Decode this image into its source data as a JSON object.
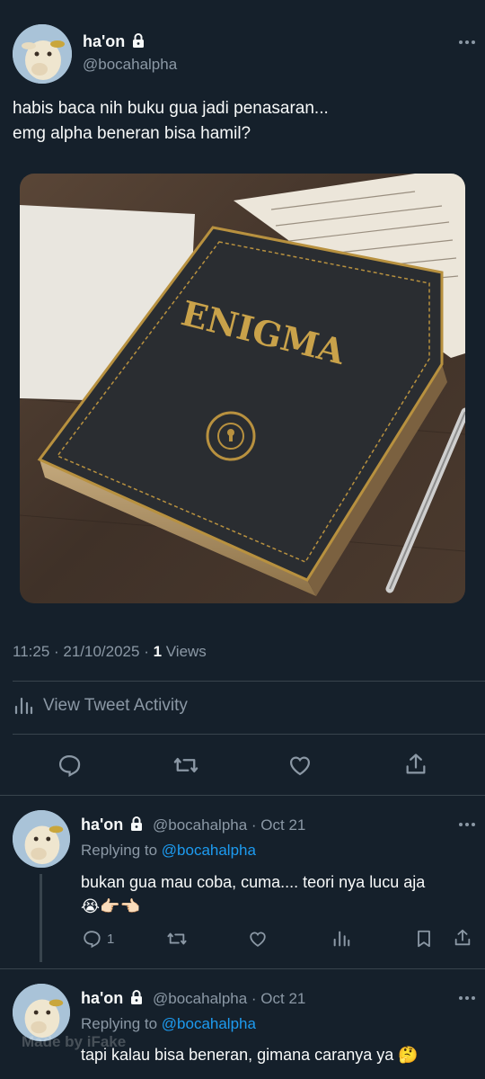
{
  "tweet": {
    "author_name": "ha'on",
    "author_handle": "@bocahalpha",
    "text_line1": "habis baca nih buku gua jadi penasaran...",
    "text_line2": "emg alpha beneran bisa hamil?",
    "image_title": "ENIGMA",
    "time": "11:25 · 21/10/2025 · ",
    "views_count": "1",
    "views_label": " Views",
    "activity_label": "View Tweet Activity"
  },
  "replies": [
    {
      "author_name": "ha'on",
      "author_handle": "@bocahalpha",
      "date": "· Oct 21",
      "replying_prefix": "Replying to ",
      "replying_handle": "@bocahalpha",
      "text_line1": "bukan gua mau coba, cuma.... teori nya lucu aja",
      "text_line2": "😭👉🏻👈🏻",
      "reply_count": "1"
    },
    {
      "author_name": "ha'on",
      "author_handle": "@bocahalpha",
      "date": "· Oct 21",
      "replying_prefix": "Replying to ",
      "replying_handle": "@bocahalpha",
      "text_line1": "tapi kalau bisa beneran, gimana caranya ya 🤔"
    }
  ],
  "watermark": "Made by iFake",
  "colors": {
    "background": "#15202b",
    "accent": "#1d9bf0",
    "muted": "#8b98a5",
    "divider": "#38444d",
    "book_gold": "#b8913f"
  },
  "icons": [
    "lock-icon",
    "more-icon",
    "reply-icon",
    "retweet-icon",
    "like-icon",
    "share-icon",
    "analytics-icon",
    "bookmark-icon"
  ]
}
